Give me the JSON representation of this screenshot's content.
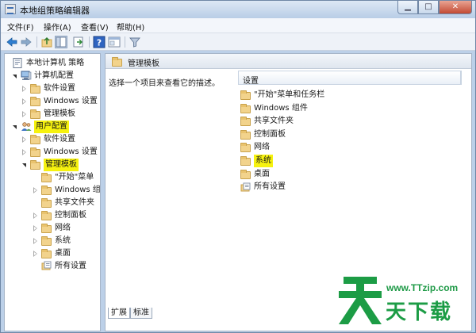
{
  "window": {
    "title": "本地组策略编辑器",
    "caption_min": "▁",
    "caption_max": "□",
    "caption_close": "✕"
  },
  "menu": [
    "文件(F)",
    "操作(A)",
    "查看(V)",
    "帮助(H)"
  ],
  "tree": [
    {
      "label": "本地计算机 策略",
      "icon": "policy-icon",
      "arrow": "none",
      "level": 0,
      "highlight": false
    },
    {
      "label": "计算机配置",
      "icon": "computer-icon",
      "arrow": "open",
      "level": 1,
      "highlight": false
    },
    {
      "label": "软件设置",
      "icon": "folder-icon",
      "arrow": "closed",
      "level": 2,
      "highlight": false
    },
    {
      "label": "Windows 设置",
      "icon": "folder-icon",
      "arrow": "closed",
      "level": 2,
      "highlight": false
    },
    {
      "label": "管理模板",
      "icon": "folder-icon",
      "arrow": "closed",
      "level": 2,
      "highlight": false
    },
    {
      "label": "用户配置",
      "icon": "users-icon",
      "arrow": "open",
      "level": 1,
      "highlight": true
    },
    {
      "label": "软件设置",
      "icon": "folder-icon",
      "arrow": "closed",
      "level": 2,
      "highlight": false
    },
    {
      "label": "Windows 设置",
      "icon": "folder-icon",
      "arrow": "closed",
      "level": 2,
      "highlight": false
    },
    {
      "label": "管理模板",
      "icon": "folder-icon",
      "arrow": "open",
      "level": 2,
      "highlight": true
    },
    {
      "label": "\"开始\"菜单",
      "icon": "folder-icon",
      "arrow": "none",
      "level": 3,
      "highlight": false
    },
    {
      "label": "Windows 组件",
      "icon": "folder-icon",
      "arrow": "closed",
      "level": 3,
      "highlight": false
    },
    {
      "label": "共享文件夹",
      "icon": "folder-icon",
      "arrow": "none",
      "level": 3,
      "highlight": false
    },
    {
      "label": "控制面板",
      "icon": "folder-icon",
      "arrow": "closed",
      "level": 3,
      "highlight": false
    },
    {
      "label": "网络",
      "icon": "folder-icon",
      "arrow": "closed",
      "level": 3,
      "highlight": false
    },
    {
      "label": "系统",
      "icon": "folder-icon",
      "arrow": "closed",
      "level": 3,
      "highlight": false
    },
    {
      "label": "桌面",
      "icon": "folder-icon",
      "arrow": "closed",
      "level": 3,
      "highlight": false
    },
    {
      "label": "所有设置",
      "icon": "settings-icon",
      "arrow": "none",
      "level": 3,
      "highlight": false
    }
  ],
  "right_pane": {
    "header": "管理模板",
    "description": "选择一个项目来查看它的描述。",
    "column_header": "设置",
    "items": [
      {
        "label": "\"开始\"菜单和任务栏",
        "highlight": false
      },
      {
        "label": "Windows 组件",
        "highlight": false
      },
      {
        "label": "共享文件夹",
        "highlight": false
      },
      {
        "label": "控制面板",
        "highlight": false
      },
      {
        "label": "网络",
        "highlight": false
      },
      {
        "label": "系统",
        "highlight": true
      },
      {
        "label": "桌面",
        "highlight": false
      },
      {
        "label": "所有设置",
        "highlight": false
      }
    ]
  },
  "tabs": [
    "扩展",
    "标准"
  ],
  "watermark": {
    "url": "www.TTzip.com",
    "text": "天下载"
  },
  "colors": {
    "highlight": "#f6f20f",
    "folder": "#f2d38c",
    "watermark": "#1c9c45"
  }
}
